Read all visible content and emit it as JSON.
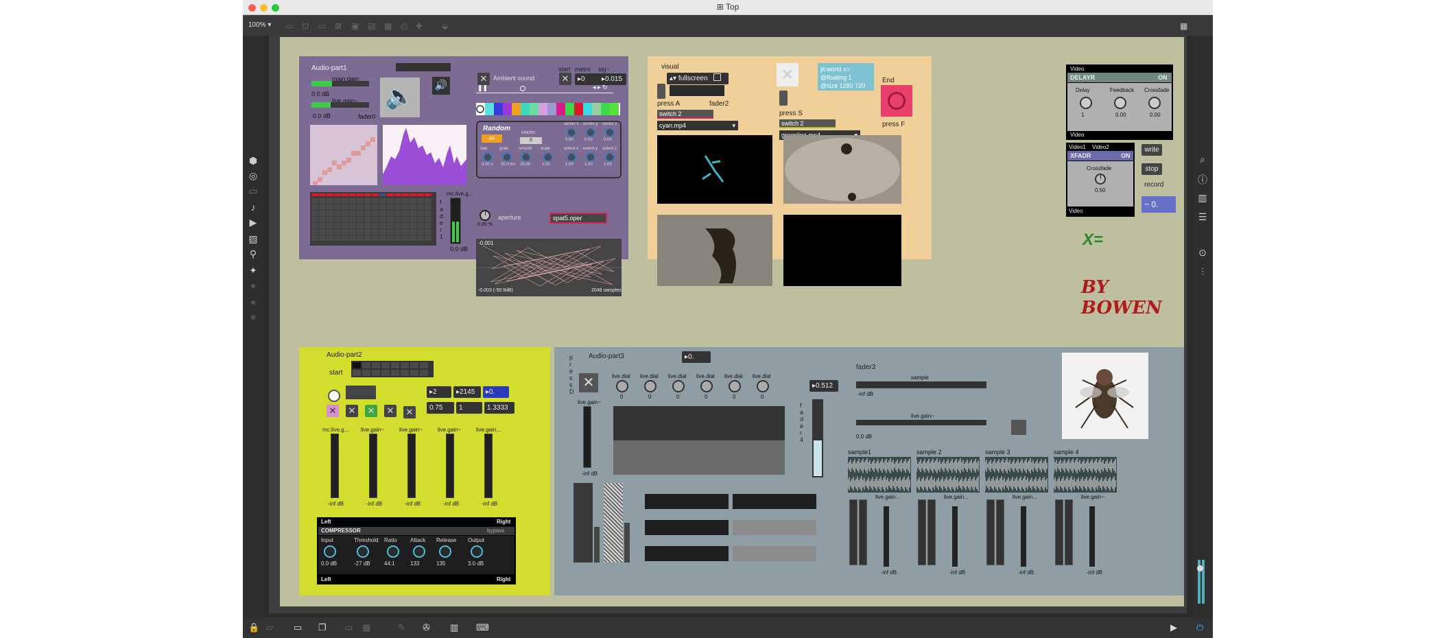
{
  "window": {
    "title": "Top",
    "zoom": "100%"
  },
  "colors": {
    "purple": "#7c6c94",
    "orange": "#f1cf98",
    "yellow": "#d2dd2d",
    "slate": "#8f9ea5",
    "patch_bg": "#bdbf9e"
  },
  "audio1": {
    "title": "Audio-part1",
    "main_gain": "main.gain",
    "main_db": "0.0 dB",
    "live_gain": "live.gain~",
    "live_db": "0.0 dB",
    "fader": "fader0",
    "start": "start",
    "metro": "metro",
    "sig": "sig~",
    "metro_val": "0",
    "sig_val": "0.015",
    "ambient": "Ambient sound",
    "random": {
      "title": "Random",
      "on": "on",
      "voices": "voices",
      "voices_val": "8",
      "knobs": [
        {
          "l": "center x",
          "v": "0.00"
        },
        {
          "l": "center y",
          "v": "0.00"
        },
        {
          "l": "center z",
          "v": "0.00"
        },
        {
          "l": "rate",
          "v": "3.00 s"
        },
        {
          "l": "grain",
          "v": "30.0 ms"
        },
        {
          "l": "smooth",
          "v": "25.00"
        },
        {
          "l": "scale",
          "v": "1.00"
        },
        {
          "l": "extent x",
          "v": "1.00"
        },
        {
          "l": "extent y",
          "v": "1.00"
        },
        {
          "l": "extent z",
          "v": "1.00"
        }
      ]
    },
    "aperture": "aperture",
    "aperture_val": "0.00 %",
    "spat": "spat5.oper",
    "mc_gain": "mc.live.g...",
    "mc_db": "0.0 dB",
    "fader1": "f a d e r 1",
    "scope_top": "-0.001",
    "scope_bottom": "-0.003 (-50.9dB)",
    "scope_samples": "2048 samples"
  },
  "visual": {
    "title": "visual",
    "fullscreen": "fullscreen",
    "press_a": "press A",
    "fader2": "fader2",
    "switch_a": "switch 2",
    "file_a": "cyan.mp4",
    "press_s": "press S",
    "switch_s": "switch 2",
    "file_s": "greenline.mp4",
    "msg": [
      "jit.world x=",
      "@floating 1",
      "@size 1280 720"
    ],
    "end": "End",
    "press_f": "press F",
    "delay": {
      "video": "Video",
      "name": "DELAYR",
      "on": "ON",
      "knobs": [
        {
          "l": "Delay",
          "v": "1"
        },
        {
          "l": "Feedback",
          "v": "0.00"
        },
        {
          "l": "Crossfade",
          "v": "0.00"
        }
      ],
      "video_out": "Video"
    },
    "xfade": {
      "v1": "Video1",
      "v2": "Video2",
      "name": "XFADR",
      "on": "ON",
      "knob": "Crossfade",
      "val": "0.50",
      "video_out": "Video"
    },
    "write": "write",
    "stop": "stop",
    "record": "record",
    "out": "~ 0.",
    "logo": "X=",
    "signature": "BY BOWEN"
  },
  "audio2": {
    "title": "Audio-part2",
    "start": "start",
    "n1": "2",
    "n2": "2145",
    "n3": "0.",
    "n4": "0.75",
    "n5": "1",
    "n6": "1.3333",
    "channels": [
      {
        "l": "mc.live.g...",
        "db": "-inf dB"
      },
      {
        "l": "live.gain~",
        "db": "-inf dB"
      },
      {
        "l": "live.gain~",
        "db": "-inf dB"
      },
      {
        "l": "live.gain~",
        "db": "-inf dB"
      },
      {
        "l": "live.gain...",
        "db": "-inf dB"
      }
    ],
    "comp": {
      "left": "Left",
      "right": "Right",
      "title": "COMPRESSOR",
      "bypass": "bypass",
      "knobs": [
        {
          "l": "Input",
          "v": "0.0 dB"
        },
        {
          "l": "Threshold",
          "v": "-27 dB"
        },
        {
          "l": "Ratio",
          "v": "44:1"
        },
        {
          "l": "Attack",
          "v": "133"
        },
        {
          "l": "Release",
          "v": "135"
        },
        {
          "l": "Output",
          "v": "3.0 dB"
        }
      ]
    }
  },
  "audio3": {
    "title": "Audio-part3",
    "num": "0.",
    "press": "p r e s s D",
    "dials": [
      {
        "l": "live.dial",
        "v": "0"
      },
      {
        "l": "live.dial",
        "v": "0"
      },
      {
        "l": "live.dial",
        "v": "0"
      },
      {
        "l": "live.dial",
        "v": "0"
      },
      {
        "l": "live.dial",
        "v": "0"
      },
      {
        "l": "live.dial",
        "v": "0"
      }
    ],
    "live_gain": "live.gain~",
    "live_db": "-inf dB",
    "fader4": "f a d e r 4",
    "fader4_val": "0.512",
    "fader3": "fader3",
    "sample": "sample",
    "sample_db": "-inf dB",
    "live_gain2": "live.gain~",
    "live_gain2_db": "0.0 dB",
    "samples": [
      {
        "l": "sample1",
        "g": "live.gain...",
        "db": "-inf dB"
      },
      {
        "l": "sample 2",
        "g": "live.gain...",
        "db": "-inf dB"
      },
      {
        "l": "sample 3",
        "g": "live.gain...",
        "db": "-inf dB"
      },
      {
        "l": "sample 4",
        "g": "live.gain~",
        "db": "-inf dB"
      }
    ]
  }
}
